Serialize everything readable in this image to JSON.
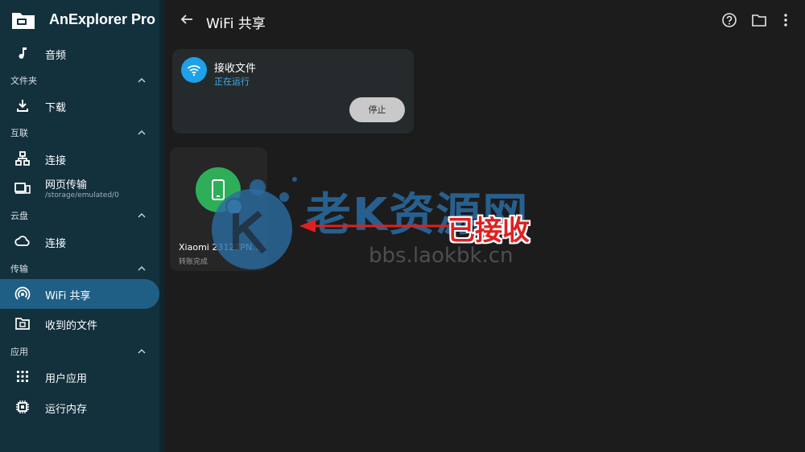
{
  "app": {
    "title": "AnExplorer Pro"
  },
  "sidebar": {
    "items": [
      {
        "label": "音频"
      },
      {
        "section": "文件夹"
      },
      {
        "label": "下载"
      },
      {
        "section": "互联"
      },
      {
        "label": "连接"
      },
      {
        "label": "网页传输",
        "sub": "/storage/emulated/0"
      },
      {
        "section": "云盘"
      },
      {
        "label": "连接"
      },
      {
        "section": "传输"
      },
      {
        "label": "WiFi 共享"
      },
      {
        "label": "收到的文件"
      },
      {
        "section": "应用"
      },
      {
        "label": "用户应用"
      },
      {
        "label": "运行内存"
      }
    ]
  },
  "toolbar": {
    "title": "WiFi 共享"
  },
  "receive": {
    "title": "接收文件",
    "status": "正在运行",
    "stop_label": "停止"
  },
  "device": {
    "name": "Xiaomi 23127PN0CC",
    "status": "转账完成"
  },
  "overlay": {
    "watermark": "老K资源网",
    "url": "bbs.laokbk.cn",
    "annotation": "已接收"
  },
  "colors": {
    "sidebar": "#13303d",
    "active": "#1f5f86",
    "accent": "#1da1e8",
    "device": "#2fae5a",
    "annotation": "#e02020"
  }
}
